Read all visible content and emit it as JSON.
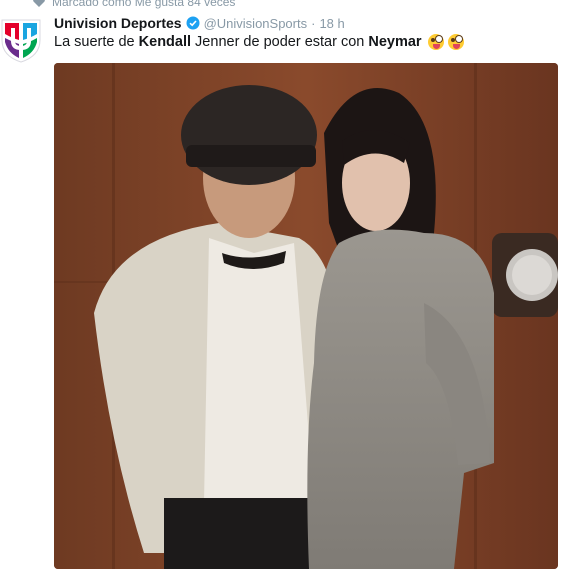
{
  "context": {
    "icon": "heart-icon",
    "text": "Marcado como Me gusta 84 veces"
  },
  "author": {
    "avatar_icon": "univision-logo",
    "name": "Univision Deportes",
    "verified_icon": "verified-badge-icon",
    "handle": "@UnivisionSports",
    "separator": "·",
    "time": "18 h"
  },
  "tweet": {
    "text_part1": "La suerte de ",
    "highlight1": "Kendall",
    "text_part2": " Jenner de poder estar con ",
    "highlight2": "Neymar",
    "emojis": [
      "face-with-tongue-emoji",
      "face-with-tongue-emoji"
    ]
  },
  "media": {
    "type": "photo"
  },
  "colors": {
    "muted": "#8899a6",
    "verified": "#1da1f2",
    "brand_purple": "#6a2c8c",
    "background_wood": "#7a3f26"
  }
}
